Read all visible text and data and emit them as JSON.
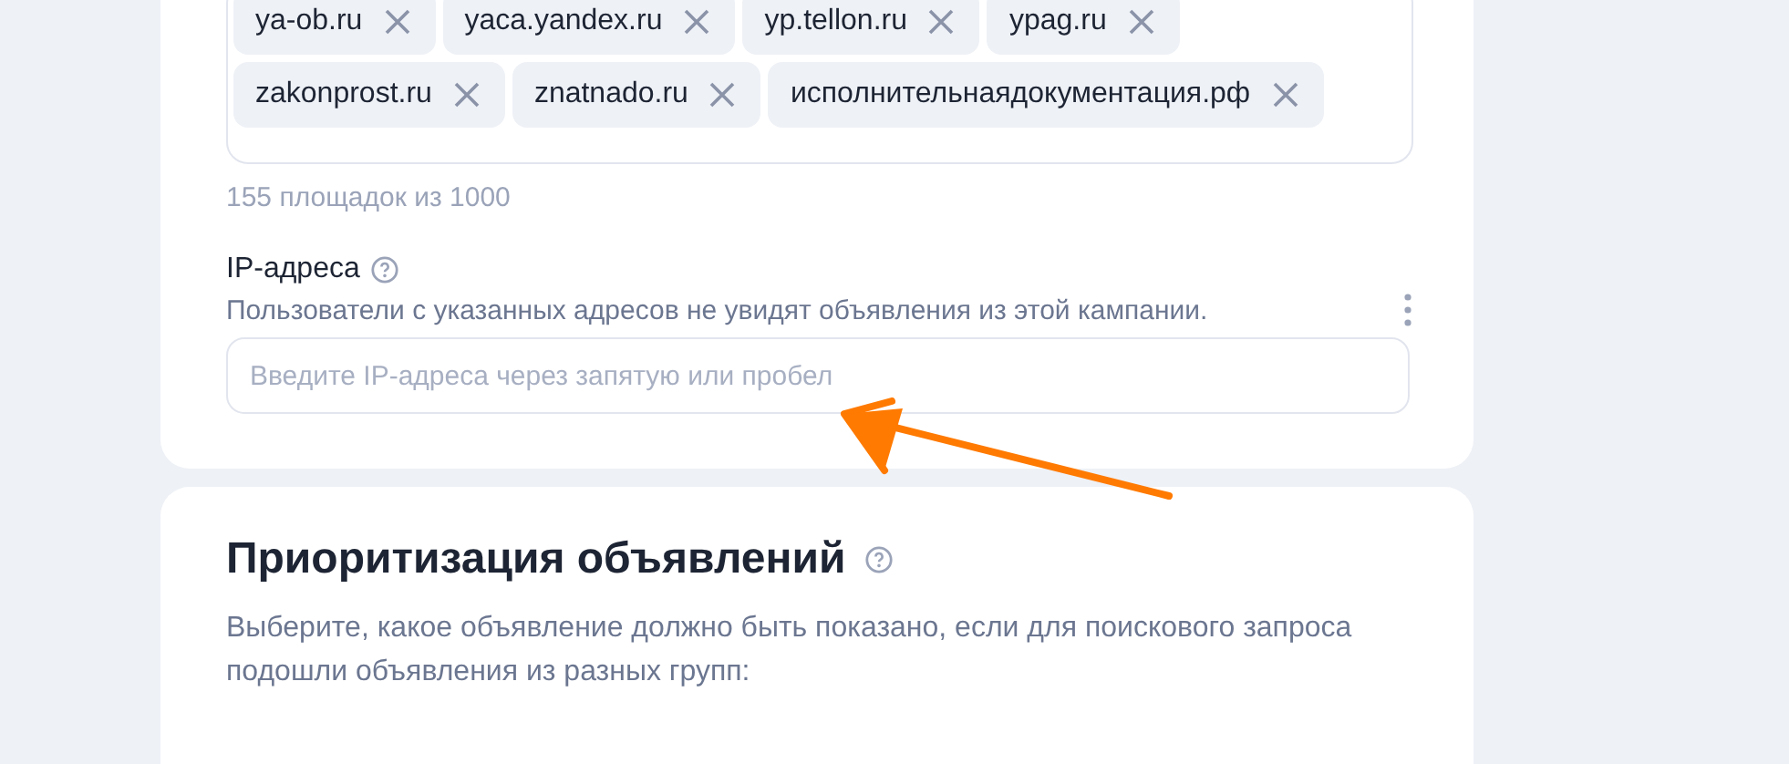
{
  "sites": {
    "tags": [
      {
        "label": "ya-ob.ru"
      },
      {
        "label": "yaca.yandex.ru"
      },
      {
        "label": "yp.tellon.ru"
      },
      {
        "label": "ypag.ru"
      },
      {
        "label": "zakonprost.ru"
      },
      {
        "label": "znatnado.ru"
      },
      {
        "label": "исполнительнаядокументация.рф"
      }
    ],
    "counter": "155 площадок из 1000"
  },
  "ip": {
    "label": "IP-адреса",
    "description": "Пользователи с указанных адресов не увидят объявления из этой кампании.",
    "placeholder": "Введите IP-адреса через запятую или пробел"
  },
  "prioritization": {
    "title": "Приоритизация объявлений",
    "description": "Выберите, какое объявление должно быть показано, если для поискового запроса подошли объявления из разных групп:"
  }
}
